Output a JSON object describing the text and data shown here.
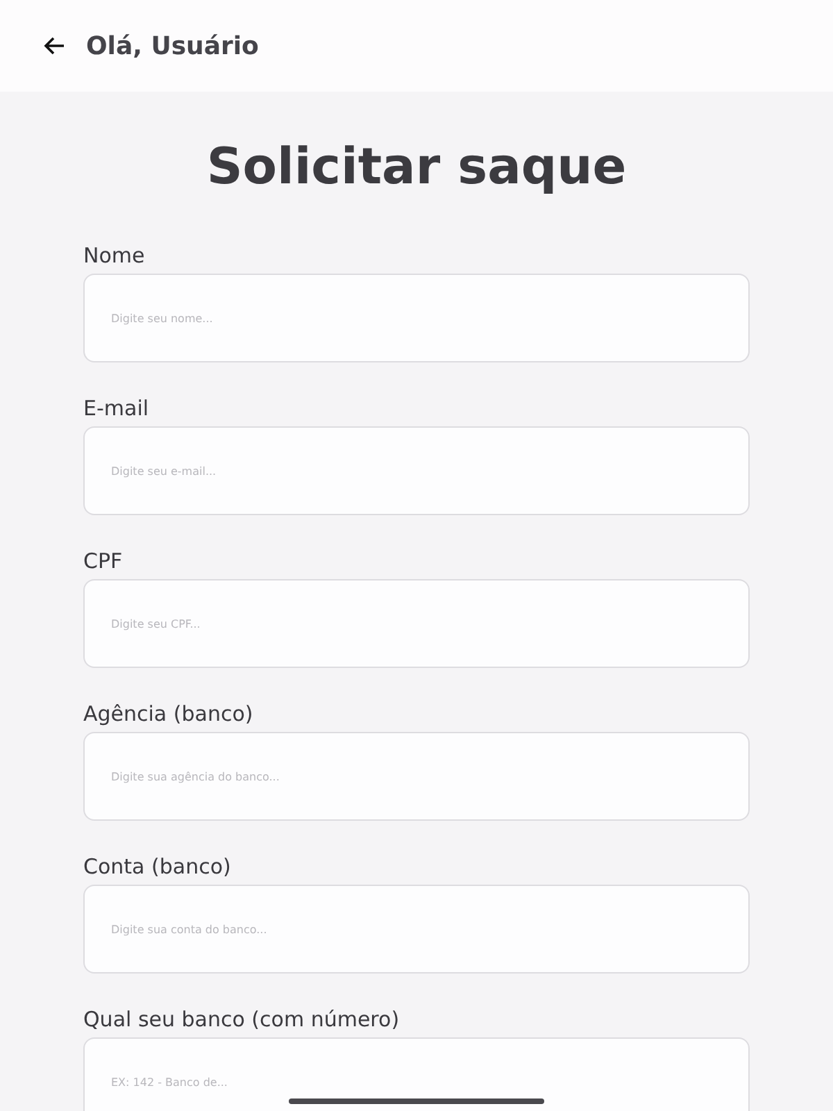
{
  "header": {
    "title": "Olá, Usuário"
  },
  "page_title": "Solicitar saque",
  "fields": [
    {
      "label": "Nome",
      "placeholder": "Digite seu nome..."
    },
    {
      "label": "E-mail",
      "placeholder": "Digite seu e-mail..."
    },
    {
      "label": "CPF",
      "placeholder": "Digite seu CPF..."
    },
    {
      "label": "Agência (banco)",
      "placeholder": "Digite sua agência do banco..."
    },
    {
      "label": "Conta (banco)",
      "placeholder": "Digite sua conta do banco..."
    },
    {
      "label": "Qual seu banco (com número)",
      "placeholder": "EX: 142 - Banco de..."
    }
  ]
}
